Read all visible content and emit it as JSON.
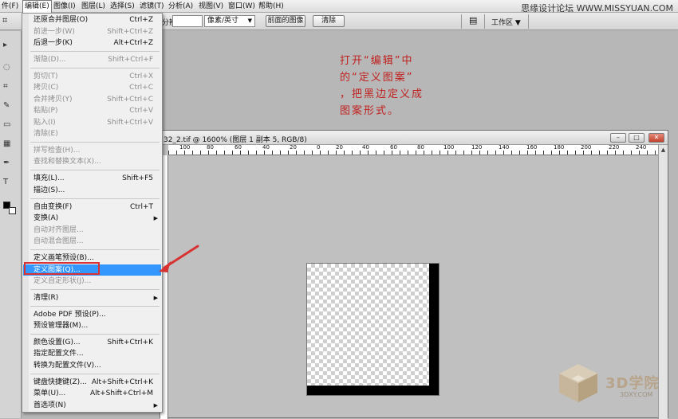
{
  "menubar": {
    "items": [
      "件(F)",
      "编辑(E)",
      "图像(I)",
      "图层(L)",
      "选择(S)",
      "滤镜(T)",
      "分析(A)",
      "视图(V)",
      "窗口(W)",
      "帮助(H)"
    ],
    "active_index": 1
  },
  "watermark_top": "思缘设计论坛  WWW.MISSYUAN.COM",
  "options_bar": {
    "res_label": "分辨率:",
    "unit_select": "像素/英寸",
    "front_image_button": "前面的图像",
    "clear_button": "清除",
    "workspace_label": "工作区"
  },
  "document": {
    "title": "32_2.tif @ 1600% (图层 1 副本 5, RGB/8)",
    "ruler_labels": [
      "100",
      "80",
      "60",
      "40",
      "20",
      "0",
      "20",
      "40",
      "60",
      "80",
      "100",
      "120",
      "140",
      "160",
      "180",
      "200",
      "220",
      "240"
    ]
  },
  "edit_menu": {
    "items": [
      {
        "label": "还原合并图层(O)",
        "shortcut": "Ctrl+Z",
        "state": "enabled"
      },
      {
        "label": "前进一步(W)",
        "shortcut": "Shift+Ctrl+Z",
        "state": "disabled"
      },
      {
        "label": "后退一步(K)",
        "shortcut": "Alt+Ctrl+Z",
        "state": "enabled"
      },
      {
        "label": "渐隐(D)...",
        "shortcut": "Shift+Ctrl+F",
        "state": "disabled"
      },
      {
        "label": "剪切(T)",
        "shortcut": "Ctrl+X",
        "state": "disabled"
      },
      {
        "label": "拷贝(C)",
        "shortcut": "Ctrl+C",
        "state": "disabled"
      },
      {
        "label": "合并拷贝(Y)",
        "shortcut": "Shift+Ctrl+C",
        "state": "disabled"
      },
      {
        "label": "粘贴(P)",
        "shortcut": "Ctrl+V",
        "state": "disabled"
      },
      {
        "label": "贴入(I)",
        "shortcut": "Shift+Ctrl+V",
        "state": "disabled"
      },
      {
        "label": "清除(E)",
        "shortcut": "",
        "state": "disabled"
      },
      {
        "label": "拼写检查(H)...",
        "shortcut": "",
        "state": "disabled"
      },
      {
        "label": "查找和替换文本(X)...",
        "shortcut": "",
        "state": "disabled"
      },
      {
        "label": "填充(L)...",
        "shortcut": "Shift+F5",
        "state": "enabled"
      },
      {
        "label": "描边(S)...",
        "shortcut": "",
        "state": "enabled"
      },
      {
        "label": "自由变换(F)",
        "shortcut": "Ctrl+T",
        "state": "enabled"
      },
      {
        "label": "变换(A)",
        "shortcut": "",
        "state": "enabled",
        "submenu": true
      },
      {
        "label": "自动对齐图层...",
        "shortcut": "",
        "state": "disabled"
      },
      {
        "label": "自动混合图层...",
        "shortcut": "",
        "state": "disabled"
      },
      {
        "label": "定义画笔预设(B)...",
        "shortcut": "",
        "state": "enabled"
      },
      {
        "label": "定义图案(Q)...",
        "shortcut": "",
        "state": "highlighted"
      },
      {
        "label": "定义自定形状(J)...",
        "shortcut": "",
        "state": "disabled"
      },
      {
        "label": "清理(R)",
        "shortcut": "",
        "state": "enabled",
        "submenu": true
      },
      {
        "label": "Adobe PDF 预设(P)...",
        "shortcut": "",
        "state": "enabled"
      },
      {
        "label": "预设管理器(M)...",
        "shortcut": "",
        "state": "enabled"
      },
      {
        "label": "颜色设置(G)...",
        "shortcut": "Shift+Ctrl+K",
        "state": "enabled"
      },
      {
        "label": "指定配置文件...",
        "shortcut": "",
        "state": "enabled"
      },
      {
        "label": "转换为配置文件(V)...",
        "shortcut": "",
        "state": "enabled"
      },
      {
        "label": "键盘快捷键(Z)...",
        "shortcut": "Alt+Shift+Ctrl+K",
        "state": "enabled"
      },
      {
        "label": "菜单(U)...",
        "shortcut": "Alt+Shift+Ctrl+M",
        "state": "enabled"
      },
      {
        "label": "首选项(N)",
        "shortcut": "",
        "state": "enabled",
        "submenu": true
      }
    ]
  },
  "annotation": {
    "lines": [
      "打开“编辑”中",
      "的“定义图案”",
      "，把黑边定义成",
      "图案形式。"
    ],
    "color": "#c0211f"
  },
  "logo": {
    "brand": "3D学院",
    "url": "3DXY.COM"
  },
  "colors": {
    "menu_highlight": "#3397fe",
    "annotation_red": "#c0211f",
    "workspace_gray": "#b7b7b7"
  }
}
